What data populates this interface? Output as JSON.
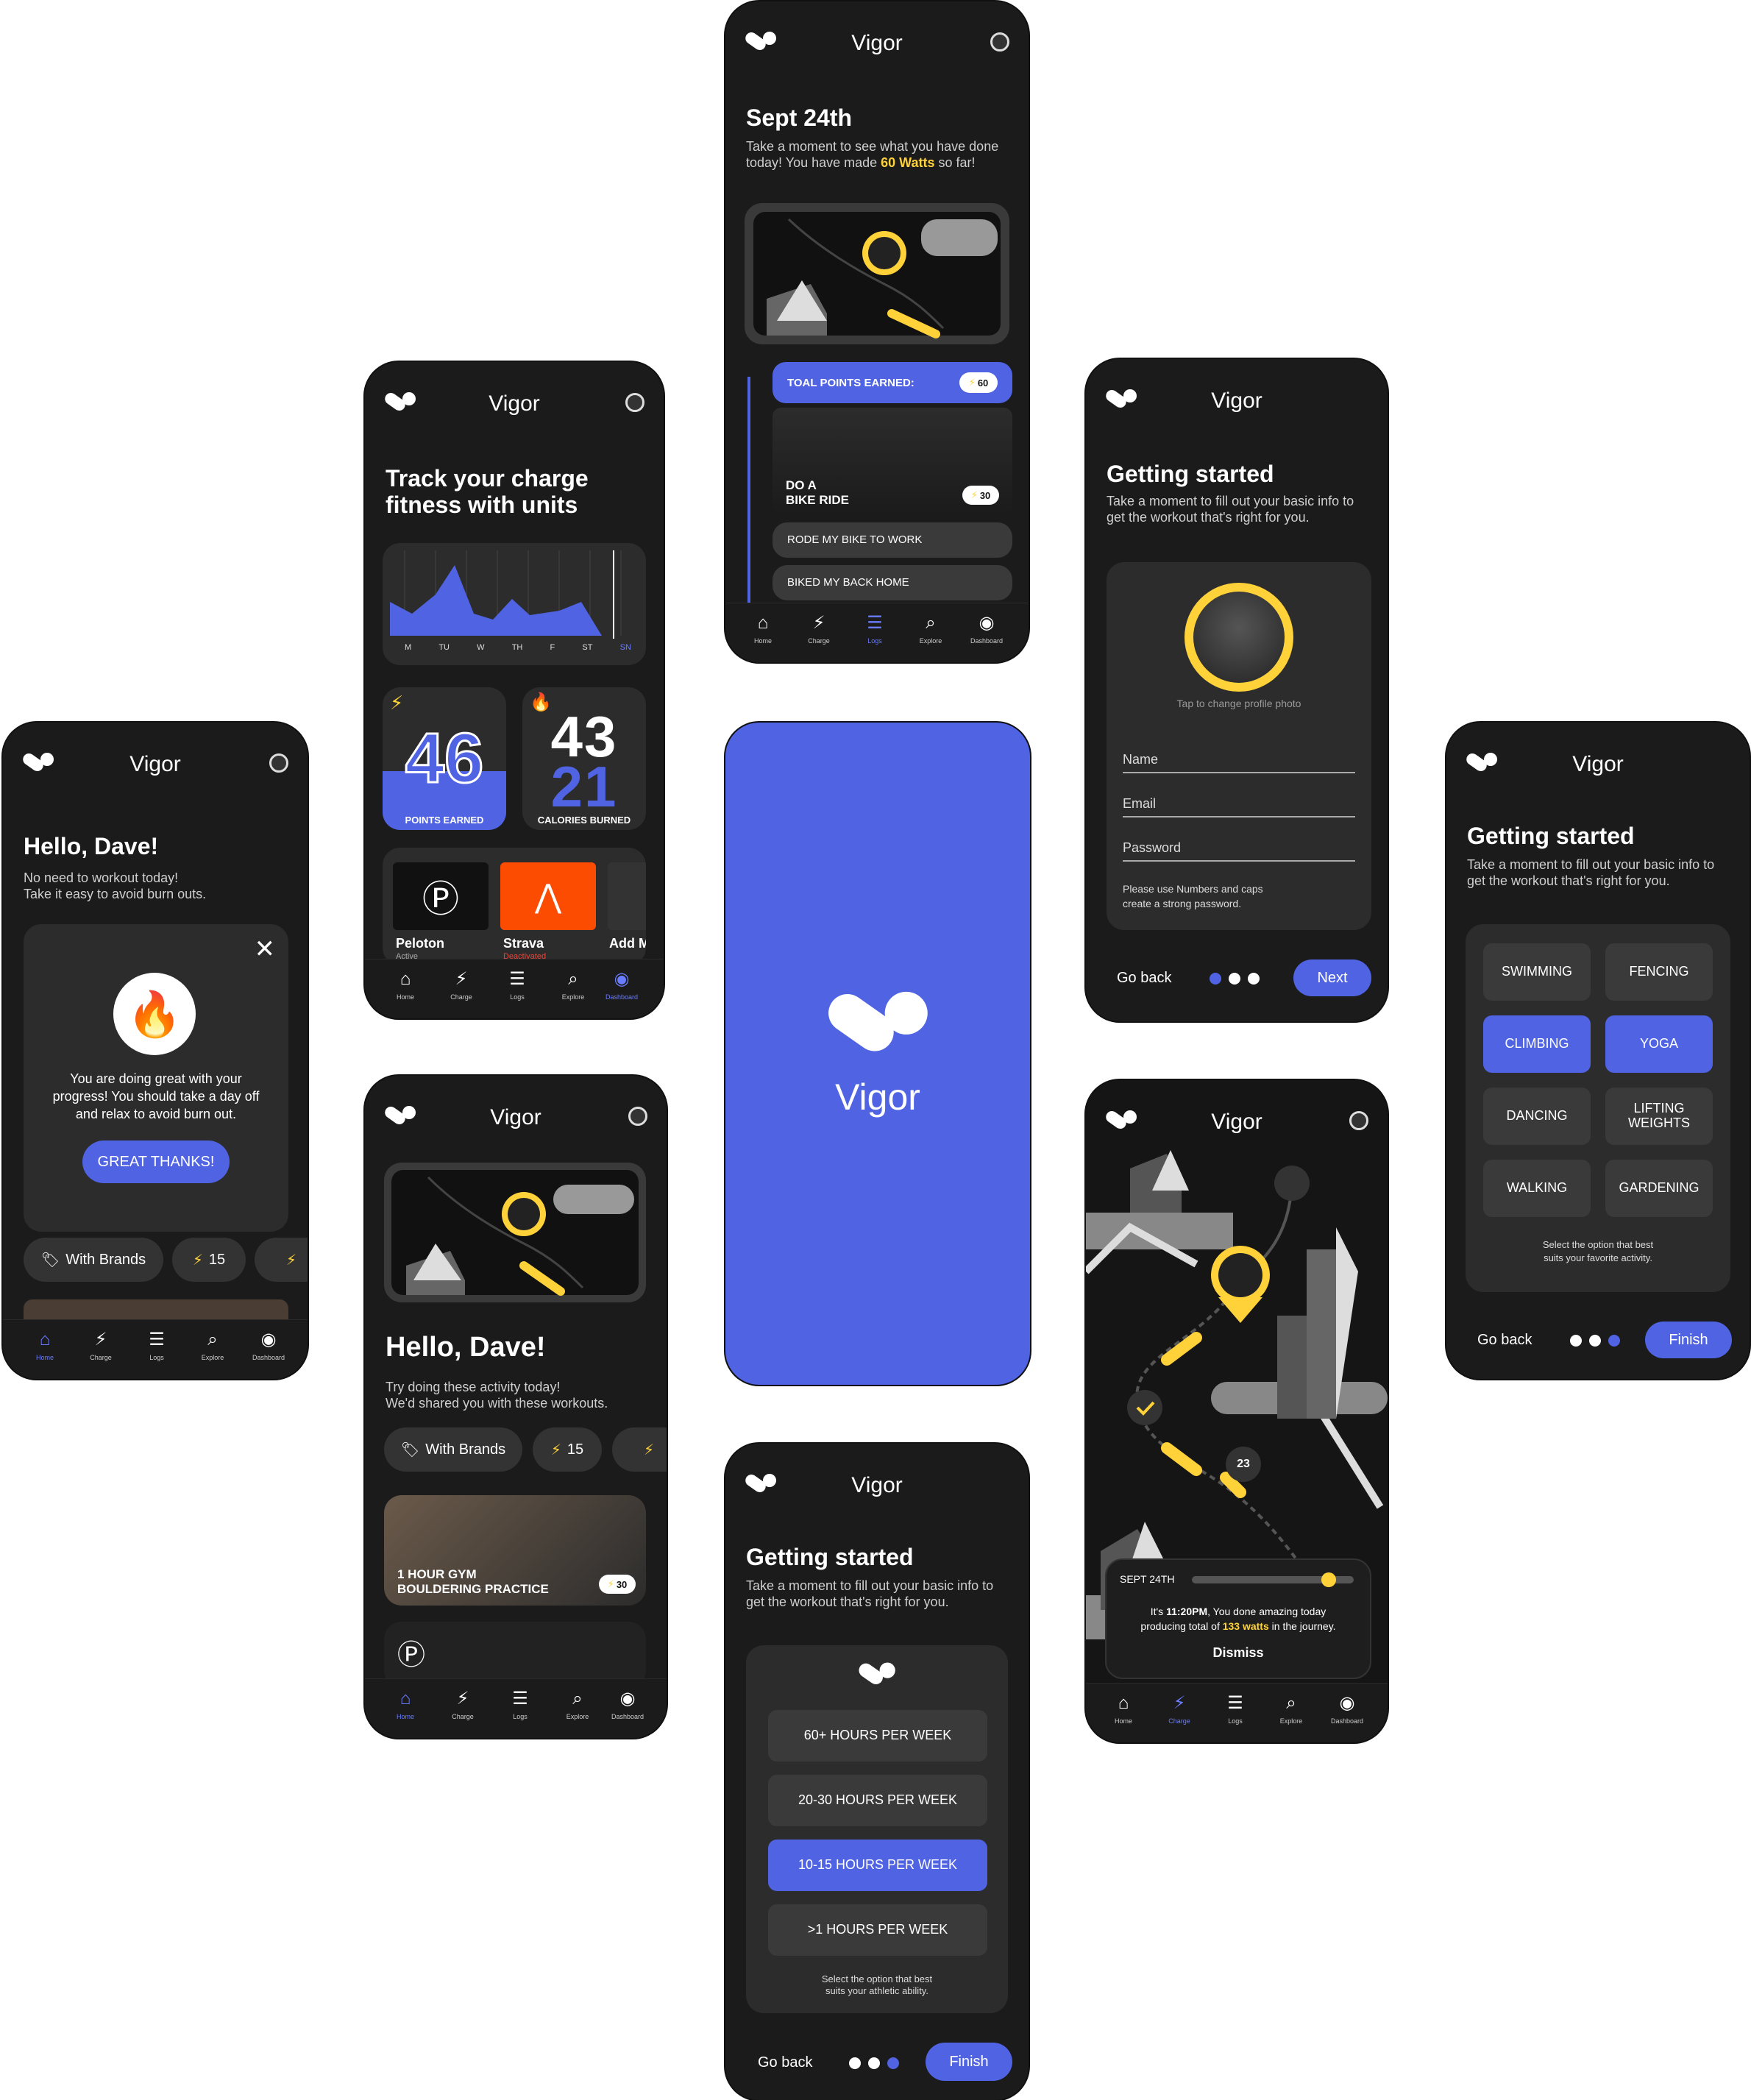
{
  "app": {
    "name": "Vigor"
  },
  "nav": {
    "home": "Home",
    "charge": "Charge",
    "logs": "Logs",
    "explore": "Explore",
    "dashboard": "Dashboard"
  },
  "hello": {
    "title": "Hello, Dave!",
    "sub1": "No need to workout today!",
    "sub2": "Take it easy to avoid burn outs.",
    "card_text1": "You are doing great with your",
    "card_text2": "progress!  You should take a day off",
    "card_text3": "and relax to avoid burn out.",
    "cta": "GREAT THANKS!",
    "chip_brands": "With Brands",
    "chip_points": "15"
  },
  "track": {
    "title1": "Track your charge",
    "title2": "fitness with units",
    "days": [
      "M",
      "TU",
      "W",
      "TH",
      "F",
      "ST",
      "SN"
    ],
    "points_value": "46",
    "points_label": "POINTS EARNED",
    "cal_top": "43",
    "cal_bottom": "21",
    "cal_label": "CALORIES BURNED",
    "brand1_name": "Peloton",
    "brand1_status": "Active",
    "brand2_name": "Strava",
    "brand2_status": "Deactivated",
    "brand3_name": "Add M"
  },
  "hello2": {
    "title": "Hello, Dave!",
    "sub1": "Try doing these activity today!",
    "sub2": "We'd shared you with these workouts.",
    "chip_brands": "With Brands",
    "chip_points": "15",
    "workout1": "1 HOUR GYM",
    "workout2": "BOULDERING PRACTICE",
    "workout_points": "30"
  },
  "sept": {
    "title": "Sept 24th",
    "sub1": "Take a moment to see what you have done",
    "sub2a": "today! You have made ",
    "sub2b": "60 Watts",
    "sub2c": " so far!",
    "total_label": "TOAL POINTS EARNED:",
    "total_value": "60",
    "ride1": "DO A",
    "ride2": "BIKE RIDE",
    "ride_points": "30",
    "log1": "RODE MY BIKE TO WORK",
    "log2": "BIKED MY BACK HOME"
  },
  "profile": {
    "title": "Getting started",
    "sub1": "Take a moment to fill out your basic info to",
    "sub2": "get the workout that's right for you.",
    "photo_hint": "Tap to change profile photo",
    "name": "Name",
    "email": "Email",
    "password": "Password",
    "hint1": "Please use Numbers and caps",
    "hint2": "create a strong password.",
    "back": "Go back",
    "next": "Next"
  },
  "map": {
    "marker": "23",
    "date": "SEPT 24TH",
    "msg1a": "It's ",
    "msg1b": "11:20PM",
    "msg1c": ", You done amazing today",
    "msg2a": "producing total of ",
    "msg2b": "133 watts",
    "msg2c": " in the journey.",
    "dismiss": "Dismiss"
  },
  "hours": {
    "title": "Getting started",
    "sub1": "Take a moment to fill out your basic info to",
    "sub2": "get the workout that's right for you.",
    "options": [
      "60+ HOURS PER WEEK",
      "20-30 HOURS PER WEEK",
      "10-15 HOURS PER WEEK",
      ">1 HOURS PER WEEK"
    ],
    "note1": "Select the option that best",
    "note2": "suits your athletic ability.",
    "back": "Go back",
    "finish": "Finish"
  },
  "activity": {
    "title": "Getting started",
    "sub1": "Take a moment to fill out your basic info to",
    "sub2": "get the workout that's right for you.",
    "options": [
      "SWIMMING",
      "FENCING",
      "CLIMBING",
      "YOGA",
      "DANCING",
      "LIFTING WEIGHTS",
      "WALKING",
      "GARDENING"
    ],
    "note1": "Select the option that best",
    "note2": "suits your favorite activity.",
    "back": "Go back",
    "finish": "Finish"
  },
  "colors": {
    "accent": "#4f63e3",
    "yellow": "#ffd23a",
    "bg": "#1b1b1b",
    "card": "#2c2c2c"
  }
}
